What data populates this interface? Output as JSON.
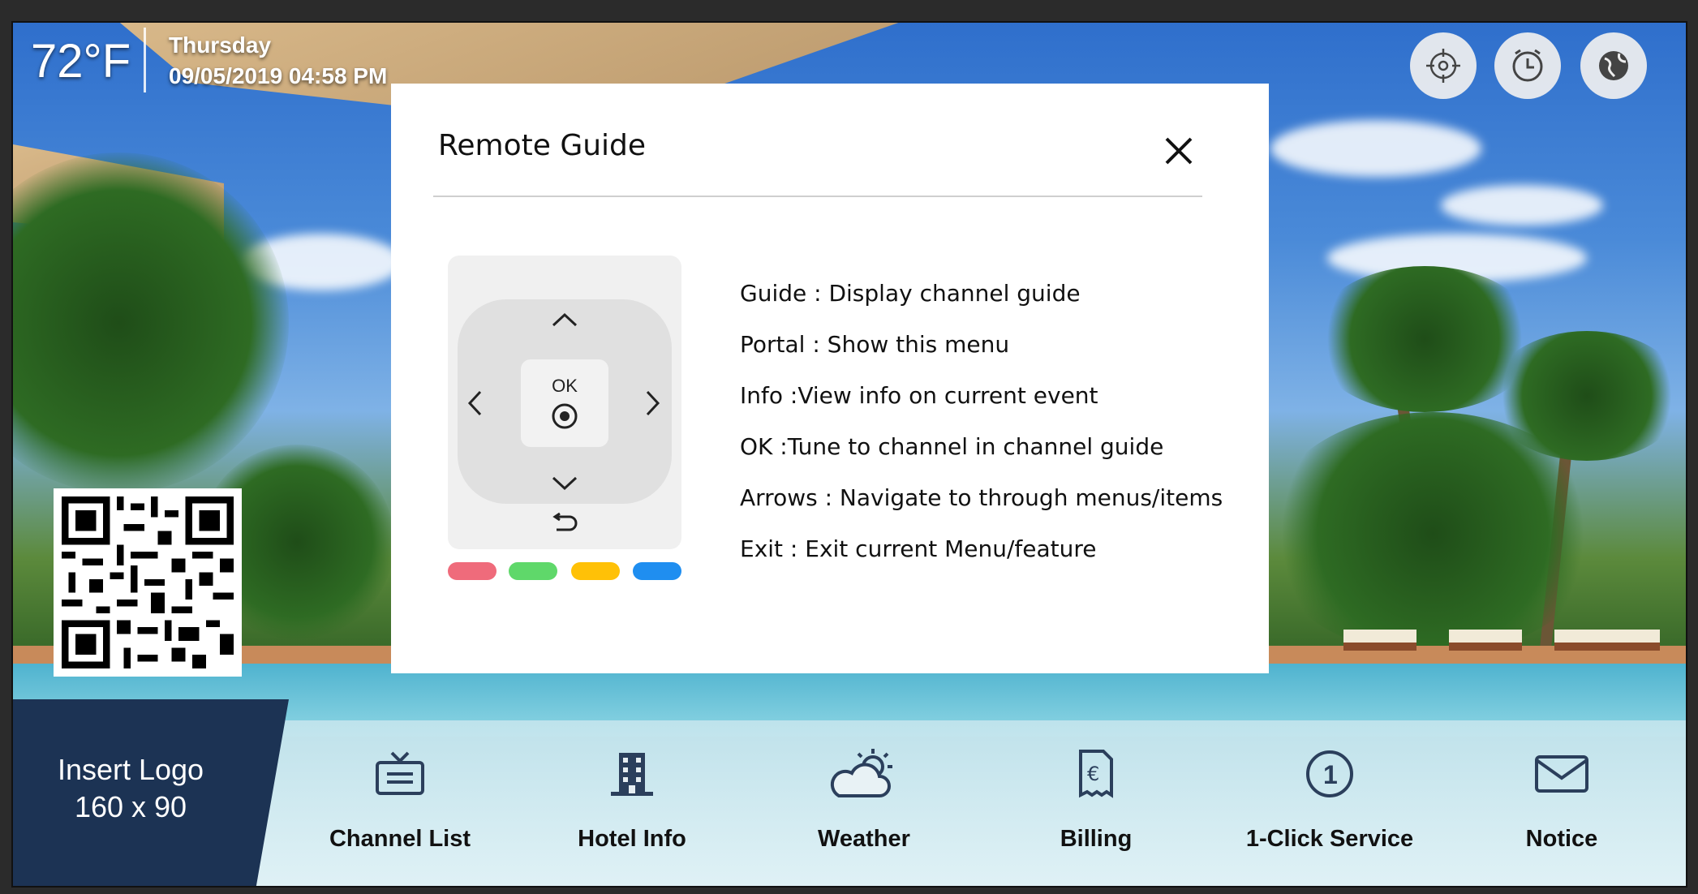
{
  "weather": {
    "temperature": "72°F",
    "day": "Thursday",
    "datetime": "09/05/2019 04:58 PM"
  },
  "top_icons": [
    "crosshair-icon",
    "clock-icon",
    "globe-icon"
  ],
  "logo": {
    "line1": "Insert Logo",
    "line2": "160 x 90"
  },
  "menu": [
    {
      "label": "Channel List",
      "icon": "tv-icon"
    },
    {
      "label": "Hotel Info",
      "icon": "building-icon"
    },
    {
      "label": "Weather",
      "icon": "weather-icon"
    },
    {
      "label": "Billing",
      "icon": "billing-icon"
    },
    {
      "label": "1-Click Service",
      "icon": "one-icon"
    },
    {
      "label": "Notice",
      "icon": "mail-icon"
    }
  ],
  "modal": {
    "title": "Remote Guide",
    "ok_label": "OK",
    "lines": [
      "Guide : Display channel guide",
      "Portal : Show this menu",
      "Info :View info on current event",
      "OK :Tune to channel in channel guide",
      "Arrows : Navigate to through menus/items",
      "Exit : Exit current Menu/feature"
    ],
    "color_keys": [
      "#ef6b7b",
      "#5fd86a",
      "#ffc107",
      "#1f8ef0"
    ]
  }
}
